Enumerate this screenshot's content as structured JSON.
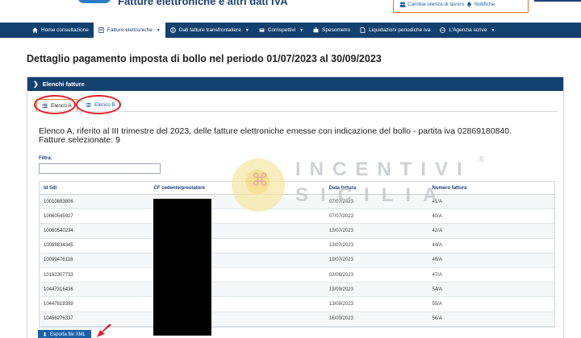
{
  "header": {
    "app_title": "Fatture elettroniche e altri dati IVA",
    "change_user": "Cambia utenza di lavoro",
    "notifications": "Notifiche"
  },
  "nav": [
    {
      "label": "Home consultazione",
      "icon": "home-icon",
      "active": false,
      "dropdown": false
    },
    {
      "label": "Fatture elettroniche",
      "icon": "document-icon",
      "active": true,
      "dropdown": true
    },
    {
      "label": "Dati fatture transfrontaliere",
      "icon": "globe-icon",
      "active": false,
      "dropdown": true
    },
    {
      "label": "Corrispettivi",
      "icon": "receipt-icon",
      "active": false,
      "dropdown": true
    },
    {
      "label": "Spesometro",
      "icon": "briefcase-icon",
      "active": false,
      "dropdown": false
    },
    {
      "label": "Liquidazioni periodiche iva",
      "icon": "file-icon",
      "active": false,
      "dropdown": false
    },
    {
      "label": "L'Agenzia scrive",
      "icon": "globe-icon",
      "active": false,
      "dropdown": true
    }
  ],
  "page_title": "Dettaglio pagamento imposta di bollo nel periodo 01/07/2023 al 30/09/2023",
  "panel": {
    "title": "Elenchi fatture",
    "tabs": [
      {
        "label": "Elenco A",
        "active": true
      },
      {
        "label": "Elenco B",
        "active": false
      }
    ],
    "description": "Elenco A, riferito al III trimestre del 2023, delle fatture elettroniche emesse con indicazione del bollo - partita iva 02869180840.",
    "selected_count": "Fatture selezionate: 9",
    "filter_label": "Filtra:",
    "filter_value": ""
  },
  "table": {
    "columns": [
      "Id Sdi",
      "CF cedente/prestatore",
      "Data fattura",
      "Numero fattura"
    ],
    "rows": [
      [
        "10010883806",
        "",
        "07/07/2023",
        "41/A"
      ],
      [
        "10060545927",
        "",
        "07/07/2023",
        "40/A"
      ],
      [
        "10060540234",
        "",
        "13/07/2023",
        "42/A"
      ],
      [
        "10068834345",
        "",
        "13/07/2023",
        "44/A"
      ],
      [
        "10099476118",
        "",
        "19/07/2023",
        "46/A"
      ],
      [
        "10192307733",
        "",
        "02/08/2023",
        "47/A"
      ],
      [
        "10447316436",
        "",
        "13/09/2023",
        "54/A"
      ],
      [
        "10447819399",
        "",
        "13/09/2023",
        "55/A"
      ],
      [
        "10466276337",
        "",
        "16/09/2023",
        "56/A"
      ]
    ]
  },
  "export_button": "Esporta file XML",
  "watermark": {
    "line1": "INCENTIVI",
    "line2": "SICILIA",
    "registered": "®"
  },
  "colors": {
    "navy": "#13416f",
    "link_blue": "#1b5fa8",
    "accent_orange": "#e8742a",
    "annotation_red": "#e01f26"
  }
}
